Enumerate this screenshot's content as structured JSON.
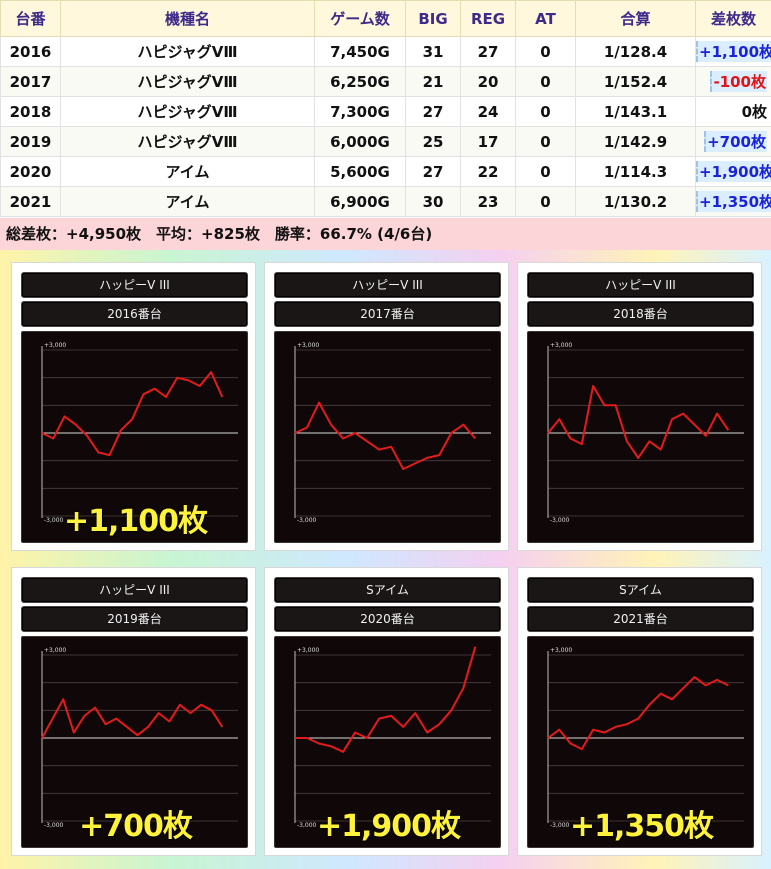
{
  "table": {
    "headers": [
      "台番",
      "機種名",
      "ゲーム数",
      "BIG",
      "REG",
      "AT",
      "合算",
      "差枚数"
    ],
    "rows": [
      {
        "num": "2016",
        "model": "ハピジャグVⅢ",
        "games": "7,450G",
        "big": "31",
        "reg": "27",
        "at": "0",
        "rate": "1/128.4",
        "diff": "+1,100枚",
        "sign": "plus"
      },
      {
        "num": "2017",
        "model": "ハピジャグVⅢ",
        "games": "6,250G",
        "big": "21",
        "reg": "20",
        "at": "0",
        "rate": "1/152.4",
        "diff": "-100枚",
        "sign": "minus"
      },
      {
        "num": "2018",
        "model": "ハピジャグVⅢ",
        "games": "7,300G",
        "big": "27",
        "reg": "24",
        "at": "0",
        "rate": "1/143.1",
        "diff": "0枚",
        "sign": "zero"
      },
      {
        "num": "2019",
        "model": "ハピジャグVⅢ",
        "games": "6,000G",
        "big": "25",
        "reg": "17",
        "at": "0",
        "rate": "1/142.9",
        "diff": "+700枚",
        "sign": "plus"
      },
      {
        "num": "2020",
        "model": "アイム",
        "games": "5,600G",
        "big": "27",
        "reg": "22",
        "at": "0",
        "rate": "1/114.3",
        "diff": "+1,900枚",
        "sign": "plus"
      },
      {
        "num": "2021",
        "model": "アイム",
        "games": "6,900G",
        "big": "30",
        "reg": "23",
        "at": "0",
        "rate": "1/130.2",
        "diff": "+1,350枚",
        "sign": "plus"
      }
    ]
  },
  "summary": "総差枚：+4,950枚　平均：+825枚　勝率：66.7% (4/6台)",
  "colors": {
    "plus": "#1a23d8",
    "minus": "#e01414",
    "line": "#e31b1b",
    "result": "#fff23a",
    "header_text": "#3d2a8a"
  },
  "chart_data": [
    {
      "type": "line",
      "machine": "ハッピーV III",
      "unit": "2016番台",
      "ylim": [
        -3000,
        3000
      ],
      "y_tick_labels": [
        "+3,000",
        "-3,000"
      ],
      "y": [
        0,
        -200,
        600,
        300,
        -100,
        -700,
        -800,
        100,
        500,
        1400,
        1600,
        1300,
        2000,
        1900,
        1700,
        2200,
        1300
      ],
      "result": "+1,100枚"
    },
    {
      "type": "line",
      "machine": "ハッピーV III",
      "unit": "2017番台",
      "ylim": [
        -3000,
        3000
      ],
      "y_tick_labels": [
        "+3,000",
        "-3,000"
      ],
      "y": [
        0,
        200,
        1100,
        300,
        -200,
        0,
        -300,
        -600,
        -500,
        -1300,
        -1100,
        -900,
        -800,
        0,
        300,
        -200
      ],
      "result": "-100枚"
    },
    {
      "type": "line",
      "machine": "ハッピーV III",
      "unit": "2018番台",
      "ylim": [
        -3000,
        3000
      ],
      "y_tick_labels": [
        "+3,000",
        "-3,000"
      ],
      "y": [
        0,
        500,
        -200,
        -400,
        1700,
        1000,
        1000,
        -300,
        -900,
        -300,
        -600,
        500,
        700,
        300,
        -100,
        700,
        100
      ],
      "result": "0枚"
    },
    {
      "type": "line",
      "machine": "ハッピーV III",
      "unit": "2019番台",
      "ylim": [
        -3000,
        3000
      ],
      "y_tick_labels": [
        "+3,000",
        "-3,000"
      ],
      "y": [
        0,
        700,
        1400,
        200,
        800,
        1100,
        500,
        700,
        400,
        100,
        400,
        900,
        600,
        1200,
        900,
        1200,
        1000,
        400
      ],
      "result": "+700枚"
    },
    {
      "type": "line",
      "machine": "Sアイム",
      "unit": "2020番台",
      "ylim": [
        -3000,
        3000
      ],
      "y_tick_labels": [
        "+3,000",
        "-3,000"
      ],
      "y": [
        0,
        0,
        -200,
        -300,
        -500,
        200,
        0,
        700,
        800,
        400,
        900,
        200,
        500,
        1000,
        1800,
        3300
      ],
      "result": "+1,900枚"
    },
    {
      "type": "line",
      "machine": "Sアイム",
      "unit": "2021番台",
      "ylim": [
        -3000,
        3000
      ],
      "y_tick_labels": [
        "+3,000",
        "-3,000"
      ],
      "y": [
        0,
        300,
        -200,
        -400,
        300,
        200,
        400,
        500,
        700,
        1200,
        1600,
        1400,
        1800,
        2200,
        1900,
        2100,
        1900
      ],
      "result": "+1,350枚"
    }
  ]
}
